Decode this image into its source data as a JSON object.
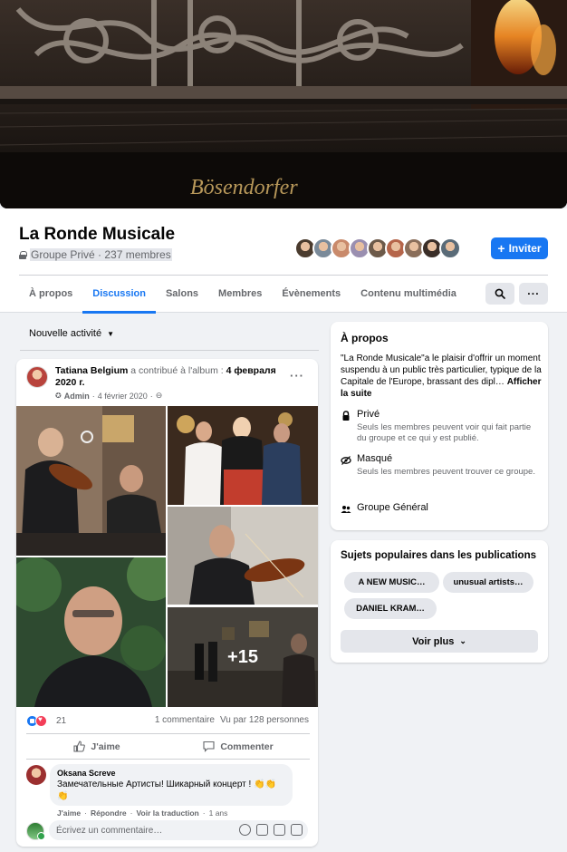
{
  "cover": {
    "brand_text": "Bösendorfer"
  },
  "group": {
    "name": "La Ronde Musicale",
    "meta": "Groupe Privé · 237 membres",
    "invite_label": "Inviter",
    "member_avatar_colors": [
      "#4a3b2e",
      "#7a8a99",
      "#c98a6b",
      "#9a8fb0",
      "#6d5a4a",
      "#b5654a",
      "#8a6e5a",
      "#3a2e28",
      "#5a6b78"
    ]
  },
  "tabs": [
    {
      "label": "À propos",
      "active": false
    },
    {
      "label": "Discussion",
      "active": true
    },
    {
      "label": "Salons",
      "active": false
    },
    {
      "label": "Membres",
      "active": false
    },
    {
      "label": "Évènements",
      "active": false
    },
    {
      "label": "Contenu multimédia",
      "active": false
    }
  ],
  "header_buttons": {
    "more_label": "···"
  },
  "sort": {
    "label": "Nouvelle activité"
  },
  "post": {
    "author": "Tatiana Belgium",
    "action_text": "a contribué à l'album :",
    "album": "4 февраля 2020 г.",
    "role": "Admin",
    "date": "4 février 2020",
    "more_label": "···",
    "extra_photos": "+15",
    "reaction_count": "21",
    "comments_count": "1 commentaire",
    "views": "Vu par 128 personnes",
    "like_label": "J'aime",
    "comment_label": "Commenter",
    "comment": {
      "author": "Oksana Screve",
      "text": "Замечательные Артисты! Шикарный концерт ! 👏👏👏",
      "like": "J'aime",
      "reply": "Répondre",
      "translate": "Voir la traduction",
      "time": "1 ans"
    },
    "write_placeholder": "Écrivez un commentaire…"
  },
  "about": {
    "title": "À propos",
    "description": "\"La Ronde Musicale\"a le plaisir d'offrir un moment suspendu à un public très particulier, typique de la Capitale de l'Europe, brassant des dipl…",
    "see_more": "Afficher la suite",
    "private_title": "Privé",
    "private_desc": "Seuls les membres peuvent voir qui fait partie du groupe et ce qui y est publié.",
    "hidden_title": "Masqué",
    "hidden_desc": "Seuls les membres peuvent trouver ce groupe.",
    "general_title": "Groupe Général"
  },
  "topics": {
    "title": "Sujets populaires dans les publications",
    "pills": [
      "A NEW MUSIC…",
      "unusual artists…",
      "DANIEL KRAM…"
    ],
    "see_more": "Voir plus"
  },
  "colors": {
    "accent": "#1877f2",
    "background": "#f0f2f5",
    "secondary_text": "#65676b"
  }
}
